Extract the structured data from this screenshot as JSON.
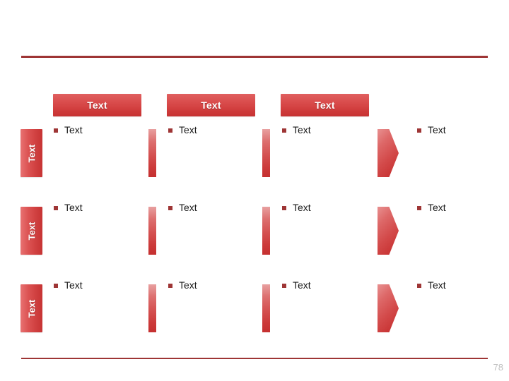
{
  "slide": {
    "page_number": "78",
    "accent_color": "#9e3535",
    "bar_color": "#d04040",
    "bullet_color": "#9e3535",
    "text_color": "#1a1a1a"
  },
  "column_headers": [
    {
      "label": "Text"
    },
    {
      "label": "Text"
    },
    {
      "label": "Text"
    }
  ],
  "rows": [
    {
      "label": "Text",
      "cells": [
        {
          "separator": "none",
          "bullet": "Text"
        },
        {
          "separator": "bar",
          "bullet": "Text"
        },
        {
          "separator": "bar",
          "bullet": "Text"
        },
        {
          "separator": "arrow",
          "bullet": "Text"
        }
      ]
    },
    {
      "label": "Text",
      "cells": [
        {
          "separator": "none",
          "bullet": "Text"
        },
        {
          "separator": "bar",
          "bullet": "Text"
        },
        {
          "separator": "bar",
          "bullet": "Text"
        },
        {
          "separator": "arrow",
          "bullet": "Text"
        }
      ]
    },
    {
      "label": "Text",
      "cells": [
        {
          "separator": "none",
          "bullet": "Text"
        },
        {
          "separator": "bar",
          "bullet": "Text"
        },
        {
          "separator": "bar",
          "bullet": "Text"
        },
        {
          "separator": "arrow",
          "bullet": "Text"
        }
      ]
    }
  ]
}
